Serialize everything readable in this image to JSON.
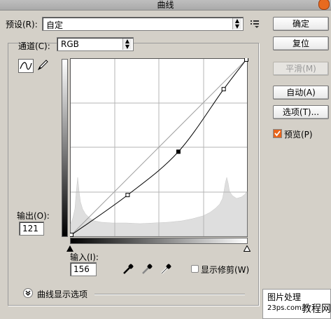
{
  "window": {
    "title": "曲线"
  },
  "preset": {
    "label": "预设(R):",
    "value": "自定"
  },
  "channel": {
    "label": "通道(C):",
    "value": "RGB"
  },
  "buttons": {
    "ok": "确定",
    "reset": "复位",
    "smooth": "平滑(M)",
    "auto": "自动(A)",
    "options": "选项(T)..."
  },
  "preview": {
    "label": "预览(P)",
    "checked": true
  },
  "output": {
    "label": "输出(O):",
    "value": "121"
  },
  "input": {
    "label": "输入(I):",
    "value": "156"
  },
  "clipping": {
    "label": "显示修剪(W)",
    "checked": false
  },
  "curve_display_options": {
    "label": "曲线显示选项"
  },
  "watermark": {
    "line1": "图片处理",
    "line2": "23ps.com",
    "line3": "教程网"
  },
  "curve": {
    "range": [
      0,
      255
    ],
    "points": [
      [
        0,
        0
      ],
      [
        82,
        58
      ],
      [
        156,
        121
      ],
      [
        222,
        212
      ],
      [
        255,
        255
      ]
    ]
  },
  "icons": {
    "curve_tool": "curve-tool-icon",
    "pencil_tool": "pencil-icon",
    "preset_menu": "preset-menu-icon",
    "black_eyedropper": "eyedropper-black-icon",
    "gray_eyedropper": "eyedropper-gray-icon",
    "white_eyedropper": "eyedropper-white-icon",
    "expand": "chevron-expand-icon"
  },
  "colors": {
    "accent_check": "#e8641a",
    "histogram": "#dedede"
  }
}
